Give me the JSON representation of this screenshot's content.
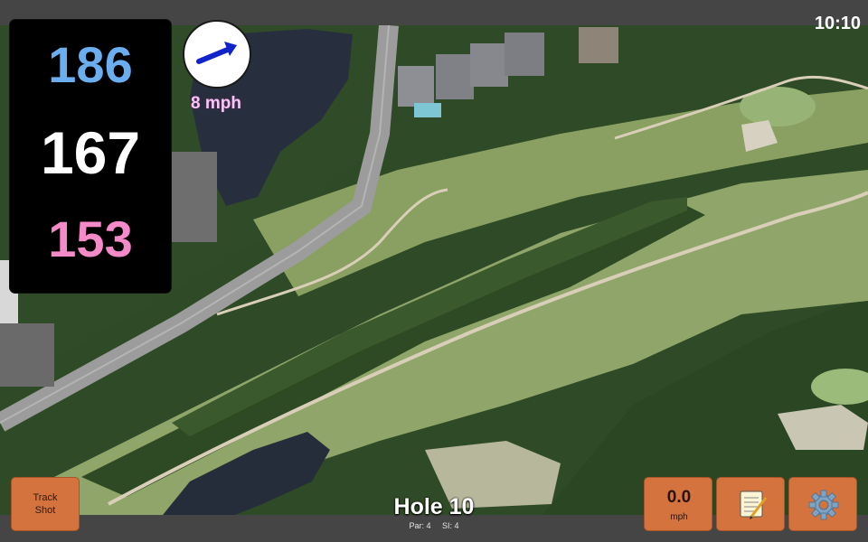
{
  "status": {
    "clock": "10:10"
  },
  "distances": {
    "back": "186",
    "middle": "167",
    "front": "153"
  },
  "wind": {
    "speed_label": "8 mph",
    "direction_icon": "arrow-icon",
    "arrow_color": "#1124cc"
  },
  "hole": {
    "title": "Hole 10",
    "par_label": "Par: 4",
    "si_label": "SI: 4"
  },
  "buttons": {
    "track_shot_line1": "Track",
    "track_shot_line2": "Shot",
    "speed_value": "0.0",
    "speed_unit": "mph",
    "notes_icon": "notepad-icon",
    "settings_icon": "gear-icon",
    "accent_color": "#d4733d"
  },
  "map": {
    "type": "satellite-golf-hole"
  }
}
